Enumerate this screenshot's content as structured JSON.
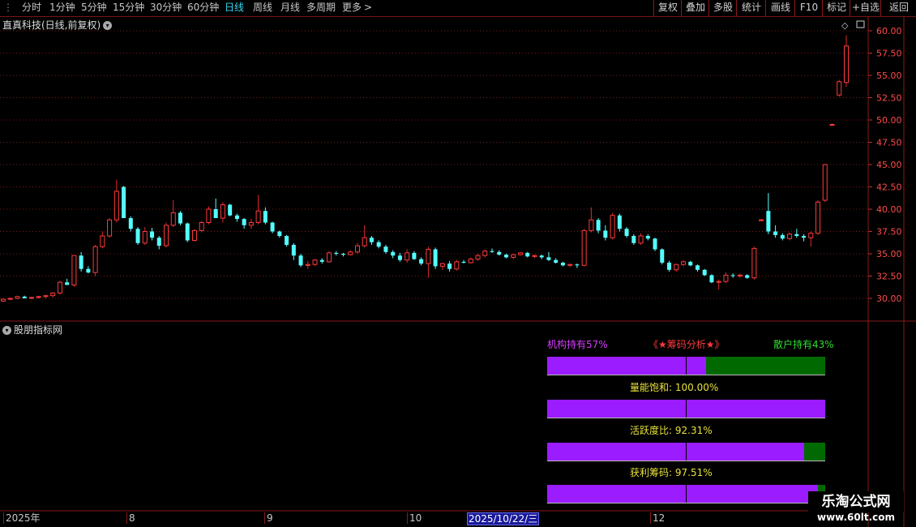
{
  "toolbar": {
    "periods": [
      "分时",
      "1分钟",
      "5分钟",
      "15分钟",
      "30分钟",
      "60分钟",
      "日线",
      "周线",
      "月线",
      "多周期",
      "更多"
    ],
    "active": "日线",
    "buttons": [
      "复权",
      "叠加",
      "多股",
      "统计",
      "画线",
      "F10",
      "标记",
      "+自选",
      "返回"
    ]
  },
  "chart": {
    "title": "直真科技(日线,前复权)",
    "price_ticks": [
      "60.00",
      "57.50",
      "55.00",
      "52.50",
      "50.00",
      "47.50",
      "45.00",
      "42.50",
      "40.00",
      "37.50",
      "35.00",
      "32.50",
      "30.00"
    ],
    "up_color": "#ff3b3b",
    "down_color": "#54ffff"
  },
  "indicator": {
    "title": "股朋指标网",
    "header_left": "机构持有57%",
    "header_center": "《★筹码分析★》",
    "header_right": "散户持有43%",
    "rows": [
      {
        "label": "",
        "percent": 57
      },
      {
        "label": "量能饱和:   100.00%",
        "percent": 100.0
      },
      {
        "label": "活跃度比:   92.31%",
        "percent": 92.31
      },
      {
        "label": "获利筹码:   97.51%",
        "percent": 97.51
      }
    ],
    "purple": "#9b1cff",
    "green": "#006a00"
  },
  "timeline": {
    "labels": [
      "2025年",
      "8",
      "9",
      "10",
      "12"
    ],
    "highlight": "2025/10/22/三"
  },
  "watermark": {
    "line1": "乐淘公式网",
    "line2": "www.60lt.com"
  },
  "chart_data": {
    "type": "candlestick",
    "title": "直真科技(日线,前复权)",
    "ylim": [
      28.5,
      61.0
    ],
    "ohlc": [
      [
        29.7,
        30.0,
        29.6,
        29.9
      ],
      [
        29.9,
        30.1,
        29.8,
        30.0
      ],
      [
        30.0,
        30.3,
        29.9,
        30.2
      ],
      [
        30.2,
        30.3,
        30.0,
        30.0
      ],
      [
        30.0,
        30.2,
        29.9,
        30.1
      ],
      [
        30.1,
        30.3,
        30.0,
        30.2
      ],
      [
        30.2,
        30.4,
        30.0,
        30.3
      ],
      [
        30.3,
        30.7,
        30.1,
        30.6
      ],
      [
        30.6,
        32.0,
        30.4,
        31.8
      ],
      [
        31.8,
        32.2,
        31.5,
        31.5
      ],
      [
        31.5,
        33.5,
        31.3,
        34.8
      ],
      [
        34.8,
        35.2,
        33.0,
        33.3
      ],
      [
        33.3,
        33.6,
        32.8,
        32.9
      ],
      [
        32.9,
        36.0,
        32.5,
        35.8
      ],
      [
        35.8,
        37.5,
        35.6,
        37.0
      ],
      [
        37.0,
        39.0,
        36.8,
        38.8
      ],
      [
        38.8,
        43.3,
        38.5,
        42.0
      ],
      [
        42.5,
        42.6,
        39.0,
        39.0
      ],
      [
        39.0,
        39.2,
        37.5,
        37.8
      ],
      [
        37.8,
        38.0,
        36.0,
        36.2
      ],
      [
        36.2,
        38.0,
        36.0,
        37.5
      ],
      [
        37.5,
        37.9,
        36.5,
        36.8
      ],
      [
        36.8,
        37.0,
        35.5,
        35.9
      ],
      [
        35.9,
        38.5,
        35.7,
        38.2
      ],
      [
        38.2,
        41.0,
        38.0,
        39.6
      ],
      [
        39.6,
        39.8,
        38.2,
        38.4
      ],
      [
        38.4,
        38.5,
        36.3,
        36.5
      ],
      [
        36.5,
        37.8,
        36.4,
        37.6
      ],
      [
        37.6,
        38.7,
        37.4,
        38.5
      ],
      [
        38.5,
        40.3,
        38.3,
        40.0
      ],
      [
        40.0,
        41.2,
        39.5,
        39.0
      ],
      [
        39.0,
        40.8,
        38.5,
        40.5
      ],
      [
        40.5,
        40.6,
        39.2,
        39.3
      ],
      [
        39.3,
        39.5,
        38.6,
        38.9
      ],
      [
        38.9,
        39.0,
        37.8,
        38.2
      ],
      [
        38.2,
        38.9,
        37.8,
        38.5
      ],
      [
        38.5,
        41.6,
        38.3,
        39.8
      ],
      [
        39.8,
        40.2,
        38.3,
        38.5
      ],
      [
        38.5,
        38.6,
        37.3,
        37.5
      ],
      [
        37.5,
        37.6,
        36.8,
        37.0
      ],
      [
        37.0,
        37.1,
        35.8,
        36.0
      ],
      [
        36.0,
        36.2,
        34.3,
        34.8
      ],
      [
        34.8,
        35.0,
        33.5,
        33.7
      ],
      [
        33.7,
        34.2,
        33.3,
        33.8
      ],
      [
        33.8,
        34.4,
        33.6,
        34.3
      ],
      [
        34.3,
        34.5,
        33.9,
        34.1
      ],
      [
        34.1,
        35.3,
        34.0,
        35.1
      ],
      [
        35.1,
        35.3,
        34.8,
        35.0
      ],
      [
        35.0,
        35.1,
        34.7,
        34.9
      ],
      [
        34.9,
        35.4,
        34.8,
        35.2
      ],
      [
        35.2,
        36.2,
        35.0,
        35.9
      ],
      [
        35.9,
        38.2,
        35.7,
        36.8
      ],
      [
        36.8,
        37.0,
        36.0,
        36.3
      ],
      [
        36.3,
        36.5,
        35.6,
        35.8
      ],
      [
        35.8,
        36.0,
        35.0,
        35.2
      ],
      [
        35.2,
        35.4,
        34.5,
        34.8
      ],
      [
        34.8,
        35.1,
        34.1,
        34.3
      ],
      [
        34.3,
        35.5,
        34.0,
        35.1
      ],
      [
        35.1,
        35.3,
        34.3,
        34.4
      ],
      [
        34.4,
        34.6,
        33.7,
        33.9
      ],
      [
        33.9,
        35.8,
        32.3,
        35.5
      ],
      [
        35.5,
        35.7,
        33.3,
        33.6
      ],
      [
        33.6,
        34.0,
        33.2,
        33.9
      ],
      [
        33.9,
        34.2,
        33.0,
        33.3
      ],
      [
        33.3,
        34.3,
        33.1,
        34.1
      ],
      [
        34.1,
        34.3,
        33.9,
        34.0
      ],
      [
        34.0,
        34.6,
        33.9,
        34.4
      ],
      [
        34.4,
        35.0,
        34.2,
        34.8
      ],
      [
        34.8,
        35.5,
        34.6,
        35.3
      ],
      [
        35.3,
        35.6,
        35.1,
        35.2
      ],
      [
        35.2,
        35.4,
        34.8,
        34.9
      ],
      [
        34.9,
        35.0,
        34.5,
        34.6
      ],
      [
        34.6,
        35.0,
        34.4,
        34.9
      ],
      [
        34.9,
        35.2,
        34.8,
        35.1
      ],
      [
        35.1,
        35.2,
        34.6,
        34.7
      ],
      [
        34.7,
        34.9,
        34.5,
        34.8
      ],
      [
        34.8,
        34.9,
        34.4,
        34.6
      ],
      [
        34.6,
        35.2,
        34.2,
        34.3
      ],
      [
        34.3,
        34.5,
        33.9,
        34.0
      ],
      [
        34.0,
        34.1,
        33.6,
        33.7
      ],
      [
        33.7,
        33.9,
        33.5,
        33.8
      ],
      [
        33.8,
        33.9,
        33.4,
        33.7
      ],
      [
        33.7,
        37.8,
        33.6,
        37.6
      ],
      [
        37.6,
        40.2,
        37.4,
        38.8
      ],
      [
        38.8,
        39.0,
        37.3,
        37.6
      ],
      [
        37.6,
        38.2,
        36.5,
        36.8
      ],
      [
        36.8,
        39.6,
        36.6,
        39.3
      ],
      [
        39.3,
        39.5,
        37.5,
        37.8
      ],
      [
        37.8,
        38.0,
        36.8,
        37.0
      ],
      [
        37.0,
        37.2,
        36.0,
        36.2
      ],
      [
        36.2,
        37.3,
        36.0,
        37.0
      ],
      [
        37.0,
        37.2,
        36.5,
        36.7
      ],
      [
        36.7,
        36.8,
        35.3,
        35.5
      ],
      [
        35.5,
        35.6,
        33.8,
        34.0
      ],
      [
        34.0,
        34.2,
        33.0,
        33.2
      ],
      [
        33.2,
        33.9,
        33.0,
        33.8
      ],
      [
        33.8,
        34.3,
        33.6,
        34.1
      ],
      [
        34.1,
        34.2,
        33.6,
        33.7
      ],
      [
        33.7,
        33.8,
        33.0,
        33.2
      ],
      [
        33.2,
        33.3,
        32.5,
        32.6
      ],
      [
        32.6,
        32.7,
        31.7,
        31.8
      ],
      [
        31.8,
        32.1,
        31.0,
        31.9
      ],
      [
        31.9,
        32.9,
        31.7,
        32.6
      ],
      [
        32.6,
        32.8,
        32.3,
        32.5
      ],
      [
        32.5,
        32.8,
        32.3,
        32.6
      ],
      [
        32.6,
        32.7,
        32.2,
        32.3
      ],
      [
        32.3,
        35.8,
        32.1,
        35.6
      ],
      [
        38.8,
        38.9,
        38.7,
        38.8
      ],
      [
        39.8,
        41.8,
        37.2,
        37.5
      ],
      [
        37.5,
        38.2,
        36.8,
        37.1
      ],
      [
        37.1,
        37.3,
        36.5,
        36.7
      ],
      [
        36.7,
        37.4,
        36.5,
        37.2
      ],
      [
        37.2,
        37.8,
        36.8,
        37.0
      ],
      [
        37.0,
        37.2,
        36.4,
        36.8
      ],
      [
        36.8,
        37.5,
        35.8,
        37.3
      ],
      [
        37.3,
        41.0,
        37.1,
        40.8
      ],
      [
        41.0,
        45.1,
        40.8,
        45.0
      ],
      [
        49.5,
        49.6,
        49.4,
        49.5
      ],
      [
        52.8,
        54.5,
        52.6,
        54.3
      ],
      [
        54.2,
        59.5,
        53.7,
        58.3
      ]
    ]
  }
}
